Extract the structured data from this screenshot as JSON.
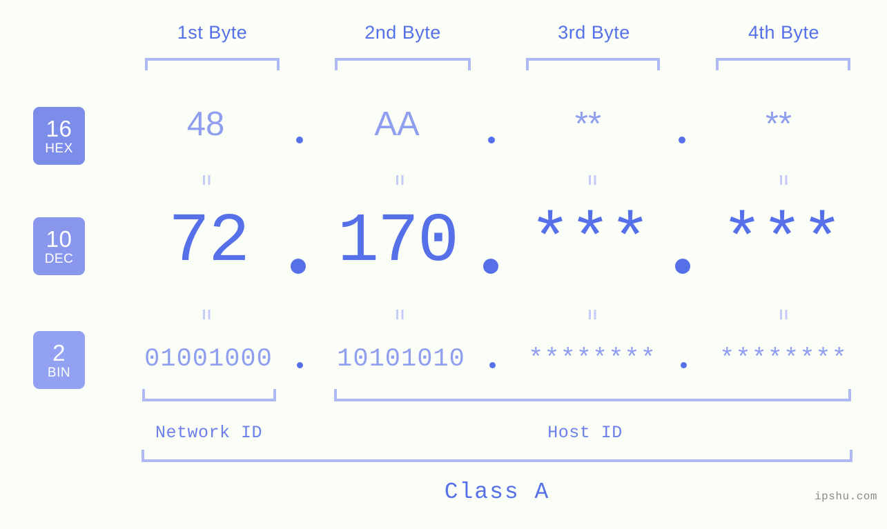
{
  "meta": {
    "watermark": "ipshu.com"
  },
  "byte_headers": [
    {
      "label": "1st Byte"
    },
    {
      "label": "2nd Byte"
    },
    {
      "label": "3rd Byte"
    },
    {
      "label": "4th Byte"
    }
  ],
  "bases": [
    {
      "number": "16",
      "name": "HEX",
      "color": "#7c8ce9"
    },
    {
      "number": "10",
      "name": "DEC",
      "color": "#8896ec"
    },
    {
      "number": "2",
      "name": "BIN",
      "color": "#92a1f2"
    }
  ],
  "rows": {
    "hex": {
      "values": [
        "48",
        "AA",
        "**",
        "**"
      ],
      "separator": "."
    },
    "dec": {
      "values": [
        "72",
        "170",
        "***",
        "***"
      ],
      "separator": "."
    },
    "bin": {
      "values": [
        "01001000",
        "10101010",
        "********",
        "********"
      ],
      "separator": "."
    }
  },
  "equals_marks": {
    "glyph": "=",
    "count_per_row": 4
  },
  "segments": {
    "network_id": "Network ID",
    "host_id": "Host ID",
    "class": "Class A"
  },
  "colors": {
    "background": "#fbfdf7",
    "accent_strong": "#5570e8",
    "accent_light": "#8f9eee",
    "bracket": "#aeb9f4",
    "equals": "#c3cbf6"
  }
}
